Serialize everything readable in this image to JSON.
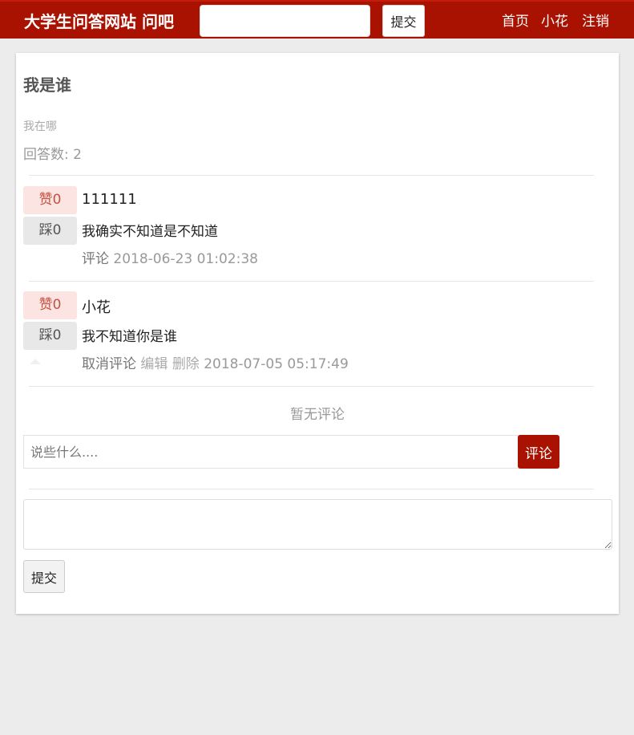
{
  "navbar": {
    "brand": "大学生问答网站 问吧",
    "search_value": "",
    "submit_label": "提交",
    "links": [
      "首页",
      "小花",
      "注销"
    ],
    "background": "#a91100"
  },
  "question": {
    "title": "我是谁",
    "description": "我在哪",
    "answer_count": "回答数: 2"
  },
  "answers": [
    {
      "like_label": "赞0",
      "dislike_label": "踩0",
      "author": "111111",
      "text": "我确实不知道是不知道",
      "actions": [
        "评论"
      ],
      "timestamp": "2018-06-23 01:02:38"
    },
    {
      "like_label": "赞0",
      "dislike_label": "踩0",
      "author": "小花",
      "text": "我不知道你是谁",
      "actions": [
        "取消评论",
        "编辑",
        "删除"
      ],
      "timestamp": "2018-07-05 05:17:49"
    }
  ],
  "comments": {
    "empty_text": "暂无评论",
    "input_placeholder": "说些什么....",
    "input_value": "",
    "button_label": "评论"
  },
  "answer_form": {
    "textarea_value": "",
    "submit_label": "提交"
  },
  "colors": {
    "accent": "#a91100",
    "like_bg": "#fbe4e1",
    "dislike_bg": "#e8e8e8"
  }
}
